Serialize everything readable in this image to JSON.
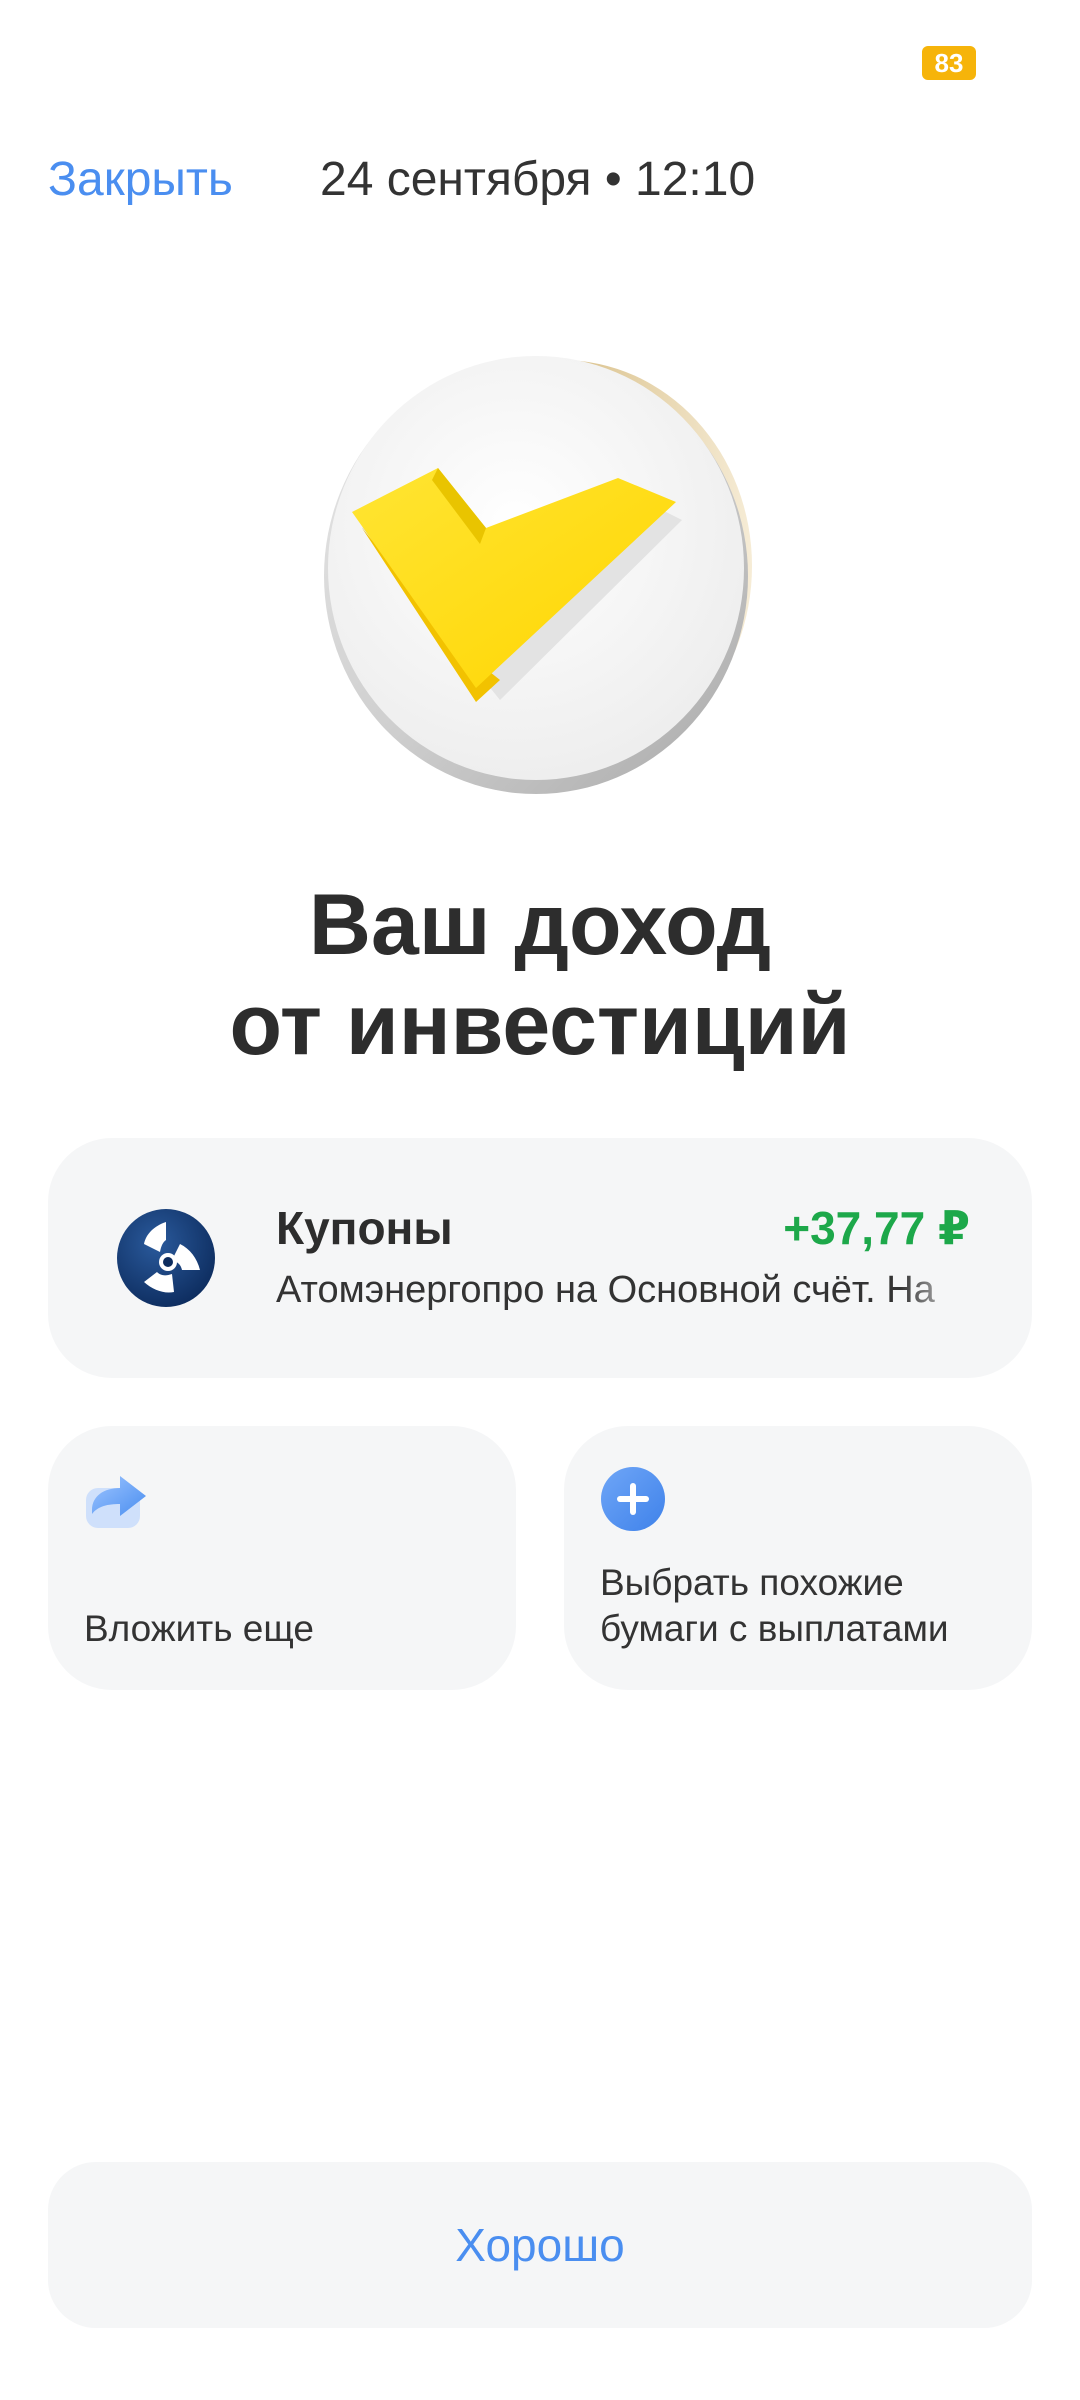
{
  "status_bar": {
    "battery_level": "83"
  },
  "header": {
    "close_label": "Закрыть",
    "datetime": "24 сентября • 12:10"
  },
  "hero": {
    "icon": "check-coin-icon"
  },
  "title": {
    "line1": "Ваш доход",
    "line2": "от инвестиций"
  },
  "coupon": {
    "label": "Купоны",
    "amount": "+37,77 ₽",
    "description": "Атомэнергопро на Основной счёт. На",
    "logo": "atomenergoprom-logo",
    "amount_color": "#1da84a"
  },
  "actions": [
    {
      "icon": "invest-share-icon",
      "label": "Вложить еще"
    },
    {
      "icon": "plus-circle-icon",
      "label": "Выбрать похожие бумаги с выплатами"
    }
  ],
  "footer": {
    "ok_label": "Хорошо"
  },
  "colors": {
    "accent": "#4a8ef0",
    "positive": "#1da84a",
    "card_bg": "#f5f6f7",
    "brand_yellow": "#ffdd2d"
  }
}
